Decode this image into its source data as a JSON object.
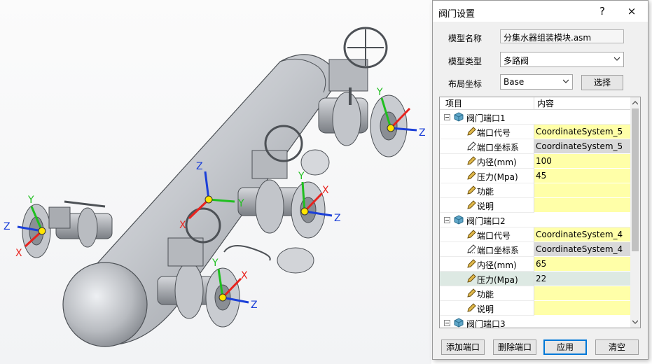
{
  "dialog": {
    "title": "阀门设置",
    "help": "?",
    "close": "×",
    "model_name_label": "模型名称",
    "model_name_value": "分集水器组装模块.asm",
    "model_type_label": "模型类型",
    "model_type_value": "多路阀",
    "layout_label": "布局坐标",
    "layout_value": "Base",
    "select_label": "选择"
  },
  "grid": {
    "col_item": "项目",
    "col_content": "内容",
    "ports": [
      {
        "name": "阀门端口1",
        "fields": {
          "code": "CoordinateSystem_5",
          "csys": "CoordinateSystem_5",
          "diameter": "100",
          "pressure": "45",
          "function": "",
          "note": ""
        }
      },
      {
        "name": "阀门端口2",
        "fields": {
          "code": "CoordinateSystem_4",
          "csys": "CoordinateSystem_4",
          "diameter": "65",
          "pressure": "22",
          "function": "",
          "note": ""
        }
      },
      {
        "name": "阀门端口3"
      }
    ],
    "field_labels": {
      "code": "端口代号",
      "csys": "端口坐标系",
      "diameter": "内径(mm)",
      "pressure": "压力(Mpa)",
      "function": "功能",
      "note": "说明"
    }
  },
  "buttons": {
    "add": "添加端口",
    "delete": "删除端口",
    "apply": "应用",
    "clear": "清空"
  },
  "axes": {
    "x": "X",
    "y": "Y",
    "z": "Z"
  },
  "colors": {
    "axis_x": "#e8231e",
    "axis_y": "#1fbf1f",
    "axis_z": "#1b3fd8",
    "highlight": "#ffffa8"
  }
}
